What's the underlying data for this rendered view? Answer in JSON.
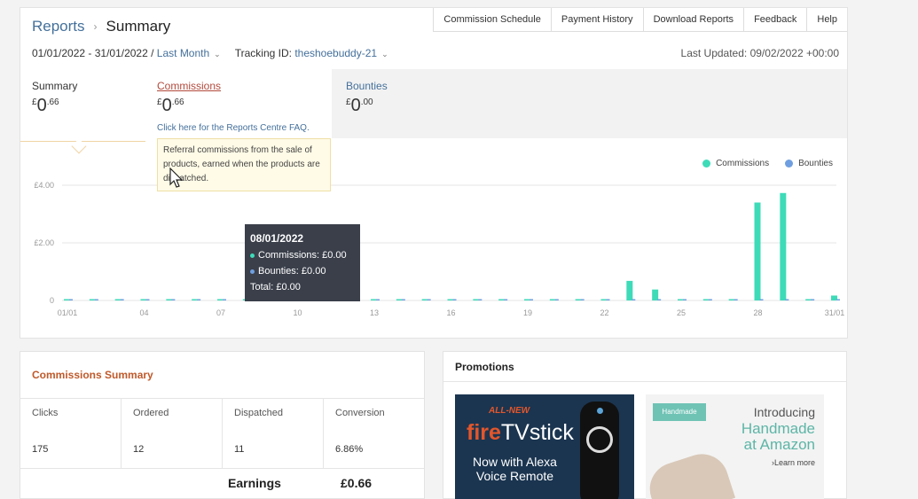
{
  "breadcrumb": {
    "root": "Reports",
    "current": "Summary",
    "separator": "›"
  },
  "topnav": [
    "Commission Schedule",
    "Payment History",
    "Download Reports",
    "Feedback",
    "Help"
  ],
  "filters": {
    "date_range": "01/01/2022 - 31/01/2022 /",
    "period": "Last Month",
    "tracking_label": "Tracking ID:",
    "tracking_id": "theshoebuddy-21",
    "last_updated": "Last Updated: 09/02/2022 +00:00"
  },
  "tabs": {
    "summary": {
      "label": "Summary",
      "currency": "£",
      "whole": "0",
      "decimal": ".66"
    },
    "commissions": {
      "label": "Commissions",
      "currency": "£",
      "whole": "0",
      "decimal": ".66",
      "faq": "Click here for the Reports Centre FAQ."
    },
    "bounties": {
      "label": "Bounties",
      "currency": "£",
      "whole": "0",
      "decimal": ".00"
    }
  },
  "info_tooltip": "Referral commissions from the sale of products, earned when the products are dispatched.",
  "legend": {
    "commissions": "Commissions",
    "bounties": "Bounties",
    "commissions_color": "#3ddbb8",
    "bounties_color": "#6f9fe0"
  },
  "chart_tooltip": {
    "date": "08/01/2022",
    "commissions": "Commissions: £0.00",
    "bounties": "Bounties: £0.00",
    "total": "Total: £0.00"
  },
  "chart_data": {
    "type": "bar",
    "ylim": [
      0,
      4.5
    ],
    "y_ticks": [
      {
        "value": 0,
        "label": "0"
      },
      {
        "value": 2,
        "label": "£2.00"
      },
      {
        "value": 4,
        "label": "£4.00"
      }
    ],
    "x_tick_labels": [
      "01/01",
      "04",
      "07",
      "10",
      "13",
      "16",
      "19",
      "22",
      "25",
      "28",
      "31/01"
    ],
    "x_tick_days": [
      1,
      4,
      7,
      10,
      13,
      16,
      19,
      22,
      25,
      28,
      31
    ],
    "days": [
      1,
      2,
      3,
      4,
      5,
      6,
      7,
      8,
      9,
      10,
      11,
      12,
      13,
      14,
      15,
      16,
      17,
      18,
      19,
      20,
      21,
      22,
      23,
      24,
      25,
      26,
      27,
      28,
      29,
      30,
      31
    ],
    "series": [
      {
        "name": "Commissions",
        "values": [
          0,
          0,
          0,
          0,
          0,
          0,
          0,
          0,
          0,
          0,
          0,
          0,
          0,
          0,
          0,
          0,
          0,
          0,
          0,
          0,
          0,
          0,
          0.68,
          0.38,
          0,
          0,
          0,
          3.4,
          3.73,
          0,
          0.17
        ]
      },
      {
        "name": "Bounties",
        "values": [
          0,
          0,
          0,
          0,
          0,
          0,
          0,
          0,
          0,
          0,
          0,
          0,
          0,
          0,
          0,
          0,
          0,
          0,
          0,
          0,
          0,
          0,
          0,
          0,
          0,
          0,
          0,
          0,
          0,
          0,
          0
        ]
      }
    ]
  },
  "commissions_summary": {
    "title": "Commissions Summary",
    "columns": [
      {
        "head": "Clicks",
        "value": "175"
      },
      {
        "head": "Ordered",
        "value": "12"
      },
      {
        "head": "Dispatched",
        "value": "11"
      },
      {
        "head": "Conversion",
        "value": "6.86%"
      }
    ],
    "earnings_label": "Earnings",
    "earnings_value": "£0.66"
  },
  "promotions": {
    "title": "Promotions",
    "fire": {
      "all_new": "ALL-NEW",
      "fire": "fire",
      "tvstick": "TVstick",
      "line1": "Now with Alexa",
      "line2": "Voice Remote"
    },
    "handmade": {
      "logo": "Handmade",
      "intro": "Introducing",
      "title1": "Handmade",
      "title2": "at Amazon",
      "learn": "›Learn more"
    }
  }
}
